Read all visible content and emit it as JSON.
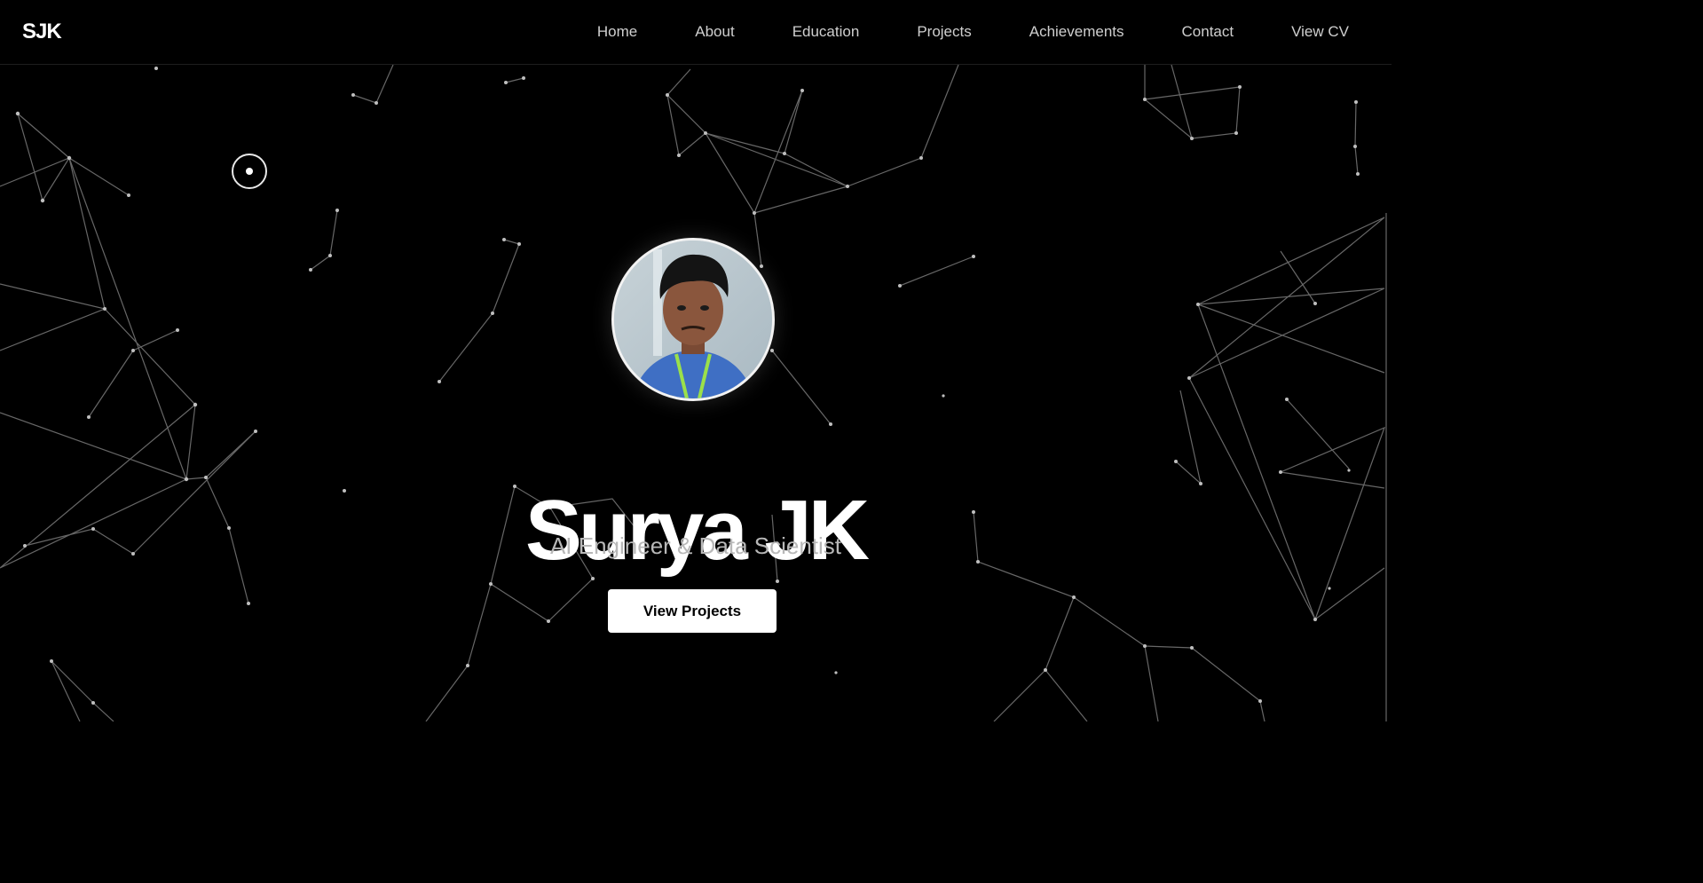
{
  "brand": {
    "logo": "SJK"
  },
  "nav": {
    "items": [
      {
        "label": "Home"
      },
      {
        "label": "About"
      },
      {
        "label": "Education"
      },
      {
        "label": "Projects"
      },
      {
        "label": "Achievements"
      },
      {
        "label": "Contact"
      },
      {
        "label": "View CV"
      }
    ]
  },
  "hero": {
    "name": "Surya JK",
    "role": "AI Engineer & Data Scientist",
    "cta_label": "View Projects",
    "avatar_icon": "profile-photo"
  },
  "theme": {
    "background": "#000000",
    "text": "#ffffff",
    "muted_text": "#b8b8b8",
    "network_line": "#8a8a8a"
  }
}
